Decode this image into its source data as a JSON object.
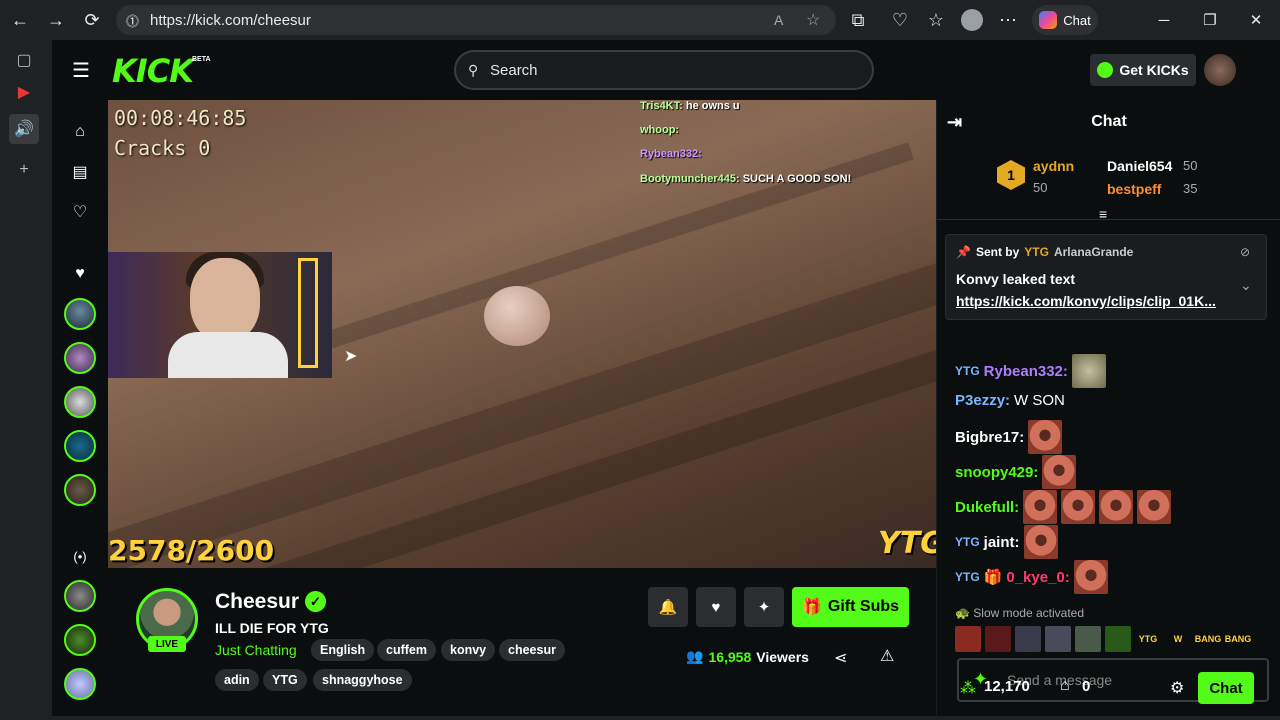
{
  "browser": {
    "url": "https://kick.com/cheesur",
    "copilot_label": "Chat"
  },
  "kick": {
    "logo": "KICK",
    "beta": "BETA",
    "search_placeholder": "Search",
    "get_kicks_label": "Get KICKs"
  },
  "video": {
    "timer": "00:08:46:85",
    "cracks": "Cracks 0",
    "counter": "2578/2600",
    "watermark": "YTG",
    "overlay_chat": [
      {
        "user": "Tris4KT:",
        "text": "he owns u",
        "color": "#b9ff9a"
      },
      {
        "user": "whoop:",
        "text": "",
        "color": "#b9ff9a"
      },
      {
        "user": "Rybean332:",
        "text": "",
        "color": "#c89aff"
      },
      {
        "user": "Bootymuncher445:",
        "text": "SUCH A GOOD SON!",
        "color": "#b9ff9a"
      }
    ]
  },
  "channel": {
    "name": "Cheesur",
    "live_label": "LIVE",
    "title": "ILL DIE FOR YTG",
    "category": "Just Chatting",
    "tags": [
      "English",
      "cuffem",
      "konvy",
      "cheesur",
      "adin",
      "YTG",
      "shnaggyhose"
    ],
    "gift_subs_label": "Gift Subs",
    "viewers_count": "16,958",
    "viewers_label": "Viewers"
  },
  "chat": {
    "header": "Chat",
    "leaderboard": {
      "first": {
        "name": "aydnn",
        "count": "50"
      },
      "second": {
        "name": "Daniel654",
        "count": "50"
      },
      "third": {
        "name": "bestpeff",
        "count": "35"
      }
    },
    "pinned": {
      "sent_by_label": "Sent by",
      "sender": "ArlanaGrande",
      "sender_badge": "YTG",
      "text": "Konvy leaked text",
      "link": "https://kick.com/konvy/clips/clip_01K..."
    },
    "messages": [
      {
        "user": "Rybean332:",
        "text": "",
        "color": "#b07cff",
        "badge": "YTG"
      },
      {
        "user": "P3ezzy:",
        "text": "W SON",
        "color": "#7fb4ff",
        "badge": ""
      },
      {
        "user": "Bigbre17:",
        "text": "",
        "color": "#ffffff",
        "badge": ""
      },
      {
        "user": "snoopy429:",
        "text": "",
        "color": "#53fc18",
        "badge": ""
      },
      {
        "user": "Dukefull:",
        "text": "",
        "color": "#53fc18",
        "badge": ""
      },
      {
        "user": "jaint:",
        "text": "",
        "color": "#ffffff",
        "badge": "YTG"
      },
      {
        "user": "0_kye_0:",
        "text": "",
        "color": "#ff3b6e",
        "badge": "YTG"
      }
    ],
    "slow_mode": "Slow mode activated",
    "emote_row": [
      "",
      "",
      "",
      "",
      "",
      "",
      "YTG",
      "W",
      "BANG",
      "BANG"
    ],
    "input_placeholder": "Send a message",
    "kicks_count": "12,170",
    "store_count": "0",
    "send_label": "Chat"
  }
}
